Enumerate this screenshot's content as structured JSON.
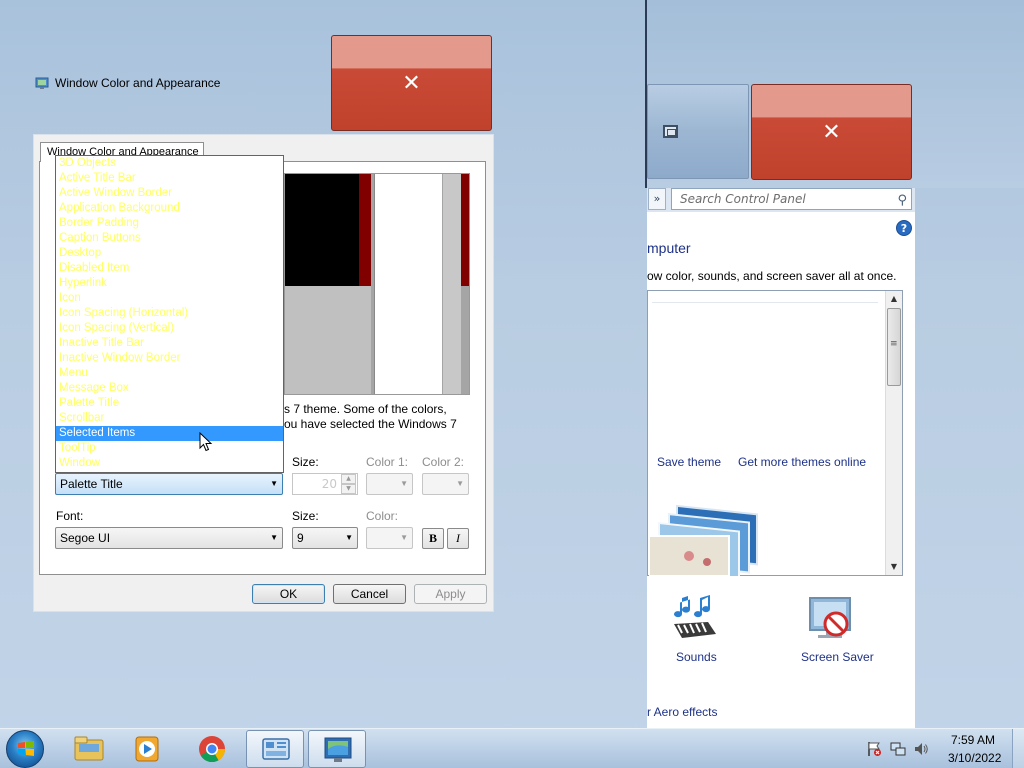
{
  "dialog": {
    "title": "Window Color and Appearance",
    "tab": "Window Color and Appearance",
    "description_line1": "s 7 theme.  Some of the colors,",
    "description_line2": "ou have selected the Windows 7",
    "item_combo_value": "Palette Title",
    "size_label": "Size:",
    "size_value": "20",
    "color1_label": "Color 1:",
    "color2_label": "Color 2:",
    "font_label": "Font:",
    "font_value": "Segoe UI",
    "font_size_label": "Size:",
    "font_size_value": "9",
    "font_color_label": "Color:",
    "bold_label": "B",
    "italic_label": "I",
    "ok": "OK",
    "cancel": "Cancel",
    "apply": "Apply",
    "close_glyph": "✕"
  },
  "item_list": {
    "items": [
      "3D Objects",
      "Active Title Bar",
      "Active Window Border",
      "Application Background",
      "Border Padding",
      "Caption Buttons",
      "Desktop",
      "Disabled Item",
      "Hyperlink",
      "Icon",
      "Icon Spacing (Horizontal)",
      "Icon Spacing (Vertical)",
      "Inactive Title Bar",
      "Inactive Window Border",
      "Menu",
      "Message Box",
      "Palette Title",
      "Scrollbar",
      "Selected Items",
      "ToolTip",
      "Window"
    ],
    "selected_index": 18,
    "text_color": "#ffff66",
    "selection_color": "#3399ff"
  },
  "control_panel": {
    "search_placeholder": "Search Control Panel",
    "heading": "mputer",
    "subtext": "ow color, sounds, and screen saver all at once.",
    "save_theme": "Save theme",
    "get_more_themes": "Get more themes online",
    "sounds": "Sounds",
    "screen_saver": "Screen Saver",
    "aero_effects": "r Aero effects",
    "help_glyph": "?",
    "close_glyph": "✕"
  },
  "taskbar": {
    "time": "7:59 AM",
    "date": "3/10/2022",
    "pinned": [
      "Windows Explorer",
      "Windows Media Player",
      "Google Chrome",
      "Control Panel",
      "Window Color and Appearance"
    ],
    "active_index": 4
  },
  "colors": {
    "close_red": "#c0412c",
    "link_blue": "#1e3287",
    "accent_blue": "#3399ff"
  }
}
